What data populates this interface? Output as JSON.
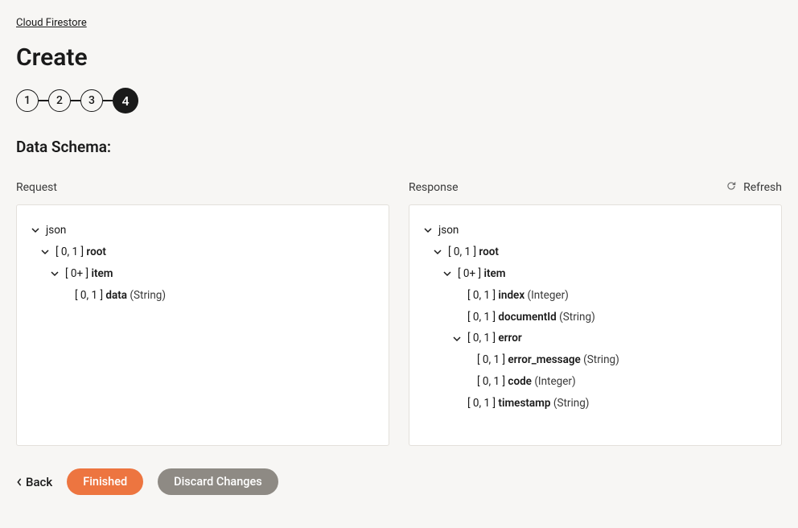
{
  "breadcrumb": "Cloud Firestore",
  "page_title": "Create",
  "stepper": {
    "steps": [
      "1",
      "2",
      "3",
      "4"
    ],
    "active_index": 3
  },
  "section_title": "Data Schema:",
  "refresh_label": "Refresh",
  "request": {
    "label": "Request",
    "root_label": "json",
    "tree": {
      "card": "[ 0, 1 ]",
      "name": "root",
      "children": [
        {
          "card": "[ 0+ ]",
          "name": "item",
          "children": [
            {
              "card": "[ 0, 1 ]",
              "name": "data",
              "type": "(String)"
            }
          ]
        }
      ]
    }
  },
  "response": {
    "label": "Response",
    "root_label": "json",
    "tree": {
      "card": "[ 0, 1 ]",
      "name": "root",
      "children": [
        {
          "card": "[ 0+ ]",
          "name": "item",
          "children": [
            {
              "card": "[ 0, 1 ]",
              "name": "index",
              "type": "(Integer)"
            },
            {
              "card": "[ 0, 1 ]",
              "name": "documentId",
              "type": "(String)"
            },
            {
              "card": "[ 0, 1 ]",
              "name": "error",
              "children": [
                {
                  "card": "[ 0, 1 ]",
                  "name": "error_message",
                  "type": "(String)"
                },
                {
                  "card": "[ 0, 1 ]",
                  "name": "code",
                  "type": "(Integer)"
                }
              ]
            },
            {
              "card": "[ 0, 1 ]",
              "name": "timestamp",
              "type": "(String)"
            }
          ]
        }
      ]
    }
  },
  "footer": {
    "back": "Back",
    "finished": "Finished",
    "discard": "Discard Changes"
  }
}
